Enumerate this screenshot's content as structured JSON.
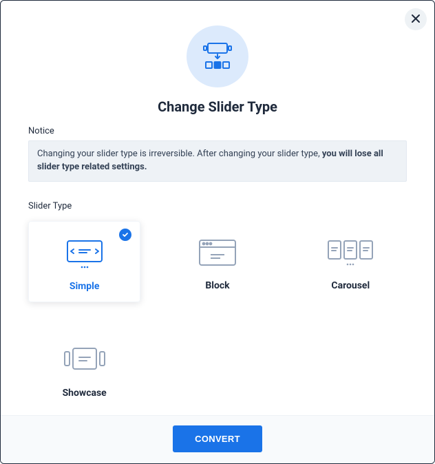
{
  "title": "Change Slider Type",
  "notice": {
    "label": "Notice",
    "text_plain": "Changing your slider type is irreversible. After changing your slider type, ",
    "text_bold": "you will lose all slider type related settings."
  },
  "slider_type": {
    "label": "Slider Type",
    "options": {
      "simple": {
        "label": "Simple",
        "selected": true
      },
      "block": {
        "label": "Block",
        "selected": false
      },
      "carousel": {
        "label": "Carousel",
        "selected": false
      },
      "showcase": {
        "label": "Showcase",
        "selected": false
      }
    }
  },
  "convert_label": "CONVERT"
}
